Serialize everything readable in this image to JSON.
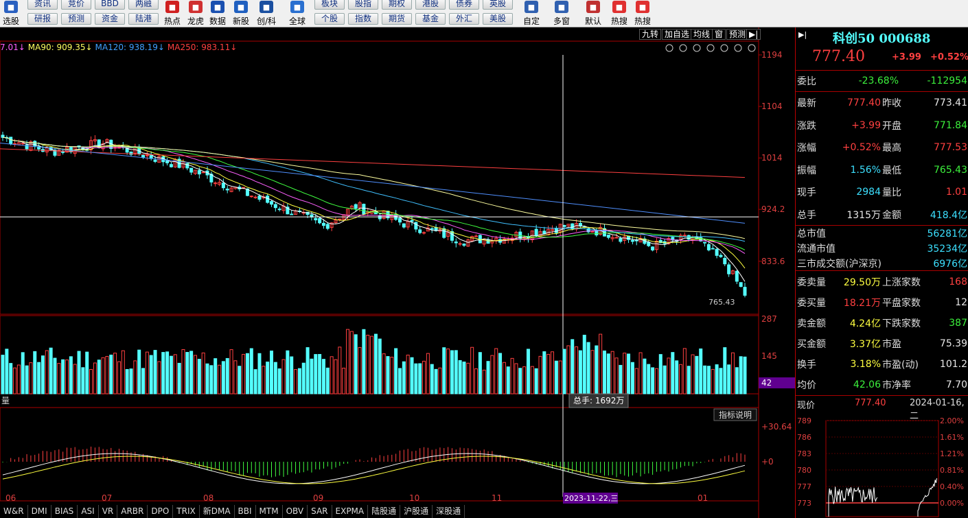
{
  "toolbar": {
    "left_items": [
      {
        "label": "选股",
        "icon": "search-icon"
      }
    ],
    "grid_buttons": [
      [
        "资讯",
        "研报"
      ],
      [
        "竞价",
        "预测"
      ],
      [
        "BBD",
        "资金"
      ],
      [
        "两融",
        "陆港"
      ]
    ],
    "icon_items_a": [
      {
        "label": "热点",
        "icon": "hbt-icon",
        "color": "#d02020"
      },
      {
        "label": "龙虎",
        "icon": "dragon-icon",
        "color": "#d03030"
      },
      {
        "label": "数据",
        "icon": "pe-icon",
        "color": "#1a50b0"
      },
      {
        "label": "新股",
        "icon": "new-stock-icon",
        "color": "#2060c0"
      },
      {
        "label": "创/科",
        "icon": "chuang-icon",
        "color": "#1a4fa0"
      },
      {
        "label": "全球",
        "icon": "globe-icon",
        "color": "#2a70d0"
      }
    ],
    "grid_buttons_b": [
      [
        "板块",
        "个股"
      ],
      [
        "股指",
        "指数"
      ],
      [
        "期权",
        "期货"
      ],
      [
        "港股",
        "基金"
      ],
      [
        "债券",
        "外汇"
      ],
      [
        "英股",
        "美股"
      ]
    ],
    "icon_items_b": [
      {
        "label": "自定",
        "icon": "custom-icon",
        "color": "#3060b0"
      },
      {
        "label": "多窗",
        "icon": "multi-window-icon",
        "color": "#3060b0"
      },
      {
        "label": "默认",
        "icon": "home-icon",
        "color": "#c03030"
      },
      {
        "label": "热搜",
        "icon": "hot-search-icon",
        "color": "#e03030"
      },
      {
        "label": "热搜",
        "icon": "hot-search-icon",
        "color": "#e03030"
      }
    ]
  },
  "chart_tabs": [
    "九转",
    "加自选",
    "均线",
    "窗",
    "预测"
  ],
  "ma_legend": [
    {
      "text": "7.01↓",
      "color": "#ff60ff"
    },
    {
      "text": "MA90: 909.35↓",
      "color": "#ffff60"
    },
    {
      "text": "MA120: 938.19↓",
      "color": "#40a0ff"
    },
    {
      "text": "MA250: 983.11↓",
      "color": "#ff4040"
    }
  ],
  "chart_tools": [
    "eye-icon",
    "hand-icon",
    "undo-icon",
    "scissors-icon",
    "lock-icon",
    "zoom-in-icon",
    "zoom-out-icon"
  ],
  "price_axis": [
    "1194",
    "1104",
    "1014",
    "924.2",
    "833.6"
  ],
  "low_label": "765.43",
  "volume_axis": [
    "287",
    "145",
    "42"
  ],
  "volume_name": "量",
  "tooltip": "总手: 1692万",
  "indicator_button": "指标说明",
  "indicator_axis": [
    "+30.64",
    "+0"
  ],
  "x_axis": [
    "06",
    "07",
    "08",
    "09",
    "10",
    "11",
    "01"
  ],
  "crosshair_date": "2023-11-22,三",
  "bottom_tabs": [
    "W&R",
    "DMI",
    "BIAS",
    "ASI",
    "VR",
    "ARBR",
    "DPO",
    "TRIX",
    "新DMA",
    "BBI",
    "MTM",
    "OBV",
    "SAR",
    "EXPMA",
    "陆股通",
    "沪股通",
    "深股通"
  ],
  "side": {
    "title": "科创50 000688",
    "price": "777.40",
    "change": "+3.99",
    "pct": "+0.52%",
    "weibi": {
      "label": "委比",
      "v1": "-23.68%",
      "v2": "-112954"
    },
    "quote_rows": [
      {
        "l": "最新",
        "v": "777.40",
        "vc": "red",
        "l2": "昨收",
        "v2": "773.41",
        "v2c": "white"
      },
      {
        "l": "涨跌",
        "v": "+3.99",
        "vc": "red",
        "l2": "开盘",
        "v2": "771.84",
        "v2c": "green"
      },
      {
        "l": "涨幅",
        "v": "+0.52%",
        "vc": "red",
        "l2": "最高",
        "v2": "777.53",
        "v2c": "red"
      },
      {
        "l": "振幅",
        "v": "1.56%",
        "vc": "cyan",
        "l2": "最低",
        "v2": "765.43",
        "v2c": "green"
      },
      {
        "l": "现手",
        "v": "2984",
        "vc": "cyan",
        "l2": "量比",
        "v2": "1.01",
        "v2c": "red"
      },
      {
        "l": "总手",
        "v": "1315万",
        "vc": "white",
        "l2": "金额",
        "v2": "418.4亿",
        "v2c": "cyan"
      }
    ],
    "cap_rows": [
      {
        "l": "总市值",
        "v": "56281亿"
      },
      {
        "l": "流通市值",
        "v": "35234亿"
      },
      {
        "l": "三市成交额(沪深京)",
        "v": "6976亿"
      }
    ],
    "stat_rows": [
      {
        "l": "委卖量",
        "v": "29.50万",
        "vc": "yellow",
        "l2": "上涨家数",
        "v2": "168",
        "v2c": "red"
      },
      {
        "l": "委买量",
        "v": "18.21万",
        "vc": "red",
        "l2": "平盘家数",
        "v2": "12",
        "v2c": "white"
      },
      {
        "l": "卖金额",
        "v": "4.24亿",
        "vc": "yellow",
        "l2": "下跌家数",
        "v2": "387",
        "v2c": "green"
      },
      {
        "l": "买金额",
        "v": "3.37亿",
        "vc": "yellow",
        "l2": "市盈",
        "v2": "75.39",
        "v2c": "white"
      },
      {
        "l": "换手",
        "v": "3.18%",
        "vc": "yellow",
        "l2": "市盈(动)",
        "v2": "101.2",
        "v2c": "white"
      },
      {
        "l": "均价",
        "v": "42.06",
        "vc": "green",
        "l2": "市净率",
        "v2": "7.70",
        "v2c": "white"
      }
    ],
    "mini": {
      "label": "现价",
      "price": "777.40",
      "date": "2024-01-16,二",
      "left_axis": [
        "789",
        "786",
        "783",
        "780",
        "777",
        "773"
      ],
      "right_axis": [
        "2.00%",
        "1.61%",
        "1.21%",
        "0.81%",
        "0.40%",
        "0.00%"
      ]
    }
  }
}
